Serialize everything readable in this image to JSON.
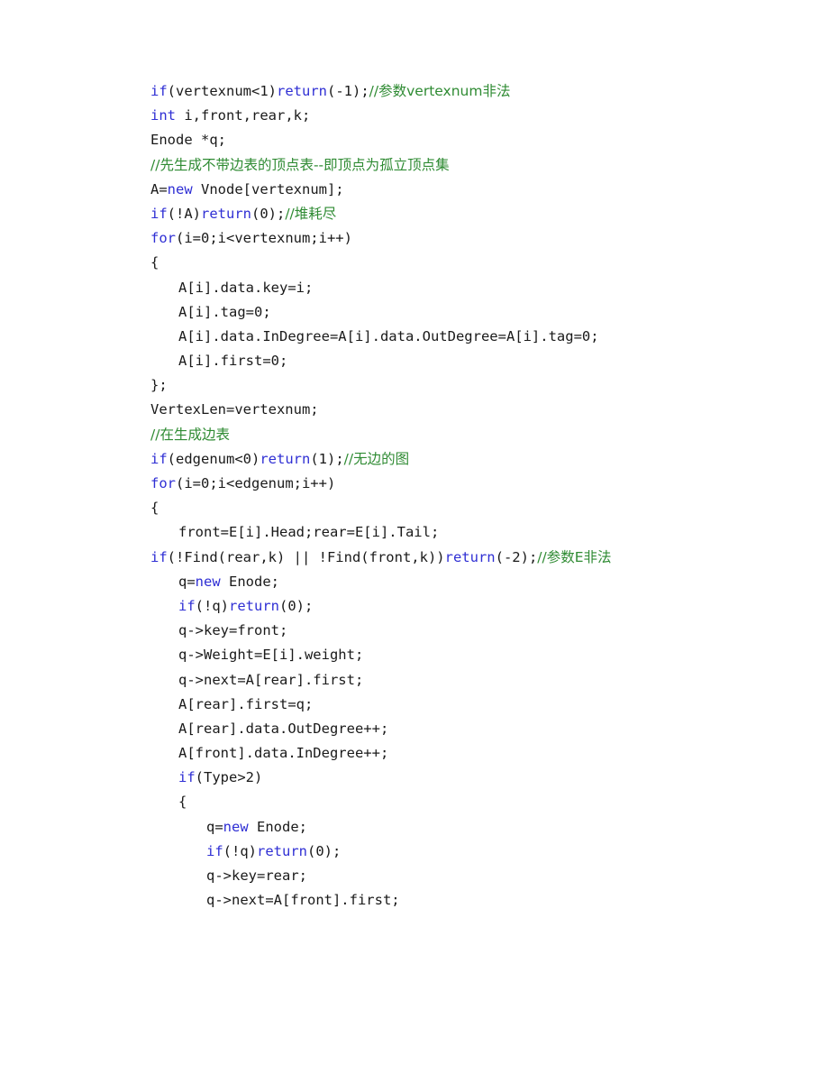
{
  "document": {
    "type": "code-listing",
    "language": "C++",
    "colors": {
      "keyword": "#2f2fd4",
      "comment": "#2f8b33",
      "text": "#1a1a1a",
      "background": "#ffffff"
    }
  },
  "code": {
    "lines": [
      {
        "indent": 0,
        "tokens": [
          {
            "t": "kw",
            "s": "if"
          },
          {
            "t": "txt",
            "s": "(vertexnum<1)"
          },
          {
            "t": "kw",
            "s": "return"
          },
          {
            "t": "txt",
            "s": "(-1);"
          },
          {
            "t": "cmt",
            "s": "//参数vertexnum非法"
          }
        ]
      },
      {
        "indent": 0,
        "tokens": [
          {
            "t": "kw",
            "s": "int"
          },
          {
            "t": "txt",
            "s": " i,front,rear,k;"
          }
        ]
      },
      {
        "indent": 0,
        "tokens": [
          {
            "t": "txt",
            "s": "Enode *q;"
          }
        ]
      },
      {
        "indent": 0,
        "tokens": [
          {
            "t": "cmt",
            "s": "//先生成不带边表的顶点表--即顶点为孤立顶点集"
          }
        ]
      },
      {
        "indent": 0,
        "tokens": [
          {
            "t": "txt",
            "s": "A="
          },
          {
            "t": "kw",
            "s": "new"
          },
          {
            "t": "txt",
            "s": " Vnode[vertexnum];"
          }
        ]
      },
      {
        "indent": 0,
        "tokens": [
          {
            "t": "kw",
            "s": "if"
          },
          {
            "t": "txt",
            "s": "(!A)"
          },
          {
            "t": "kw",
            "s": "return"
          },
          {
            "t": "txt",
            "s": "(0);"
          },
          {
            "t": "cmt",
            "s": "//堆耗尽"
          }
        ]
      },
      {
        "indent": 0,
        "tokens": [
          {
            "t": "kw",
            "s": "for"
          },
          {
            "t": "txt",
            "s": "(i=0;i<vertexnum;i++)"
          }
        ]
      },
      {
        "indent": 0,
        "tokens": [
          {
            "t": "txt",
            "s": "{"
          }
        ]
      },
      {
        "indent": 1,
        "tokens": [
          {
            "t": "txt",
            "s": "A[i].data.key=i;"
          }
        ]
      },
      {
        "indent": 1,
        "tokens": [
          {
            "t": "txt",
            "s": "A[i].tag=0;"
          }
        ]
      },
      {
        "indent": 1,
        "tokens": [
          {
            "t": "txt",
            "s": "A[i].data.InDegree=A[i].data.OutDegree=A[i].tag=0;"
          }
        ]
      },
      {
        "indent": 1,
        "tokens": [
          {
            "t": "txt",
            "s": "A[i].first=0;"
          }
        ]
      },
      {
        "indent": 0,
        "tokens": [
          {
            "t": "txt",
            "s": "};"
          }
        ]
      },
      {
        "indent": 0,
        "tokens": [
          {
            "t": "txt",
            "s": "VertexLen=vertexnum;"
          }
        ]
      },
      {
        "indent": 0,
        "tokens": [
          {
            "t": "cmt",
            "s": "//在生成边表"
          }
        ]
      },
      {
        "indent": 0,
        "tokens": [
          {
            "t": "kw",
            "s": "if"
          },
          {
            "t": "txt",
            "s": "(edgenum<0)"
          },
          {
            "t": "kw",
            "s": "return"
          },
          {
            "t": "txt",
            "s": "(1);"
          },
          {
            "t": "cmt",
            "s": "//无边的图"
          }
        ]
      },
      {
        "indent": 0,
        "tokens": [
          {
            "t": "kw",
            "s": "for"
          },
          {
            "t": "txt",
            "s": "(i=0;i<edgenum;i++)"
          }
        ]
      },
      {
        "indent": 0,
        "tokens": [
          {
            "t": "txt",
            "s": "{"
          }
        ]
      },
      {
        "indent": 1,
        "tokens": [
          {
            "t": "txt",
            "s": "front=E[i].Head;rear=E[i].Tail;"
          }
        ]
      },
      {
        "indent": 1,
        "wrap": true,
        "tokens": [
          {
            "t": "kw",
            "s": "if"
          },
          {
            "t": "txt",
            "s": "(!Find(rear,k) || !Find(front,k))"
          },
          {
            "t": "kw",
            "s": "return"
          },
          {
            "t": "txt",
            "s": "(-2);"
          },
          {
            "t": "cmt",
            "s": "//参数E非法"
          }
        ]
      },
      {
        "indent": 1,
        "tokens": [
          {
            "t": "txt",
            "s": "q="
          },
          {
            "t": "kw",
            "s": "new"
          },
          {
            "t": "txt",
            "s": " Enode;"
          }
        ]
      },
      {
        "indent": 1,
        "tokens": [
          {
            "t": "kw",
            "s": "if"
          },
          {
            "t": "txt",
            "s": "(!q)"
          },
          {
            "t": "kw",
            "s": "return"
          },
          {
            "t": "txt",
            "s": "(0);"
          }
        ]
      },
      {
        "indent": 1,
        "tokens": [
          {
            "t": "txt",
            "s": "q->key=front;"
          }
        ]
      },
      {
        "indent": 1,
        "tokens": [
          {
            "t": "txt",
            "s": "q->Weight=E[i].weight;"
          }
        ]
      },
      {
        "indent": 1,
        "tokens": [
          {
            "t": "txt",
            "s": "q->next=A[rear].first;"
          }
        ]
      },
      {
        "indent": 1,
        "tokens": [
          {
            "t": "txt",
            "s": "A[rear].first=q;"
          }
        ]
      },
      {
        "indent": 1,
        "tokens": [
          {
            "t": "txt",
            "s": "A[rear].data.OutDegree++;"
          }
        ]
      },
      {
        "indent": 1,
        "tokens": [
          {
            "t": "txt",
            "s": "A[front].data.InDegree++;"
          }
        ]
      },
      {
        "indent": 1,
        "tokens": [
          {
            "t": "kw",
            "s": "if"
          },
          {
            "t": "txt",
            "s": "(Type>2)"
          }
        ]
      },
      {
        "indent": 1,
        "tokens": [
          {
            "t": "txt",
            "s": "{"
          }
        ]
      },
      {
        "indent": 2,
        "tokens": [
          {
            "t": "txt",
            "s": "q="
          },
          {
            "t": "kw",
            "s": "new"
          },
          {
            "t": "txt",
            "s": " Enode;"
          }
        ]
      },
      {
        "indent": 2,
        "tokens": [
          {
            "t": "kw",
            "s": "if"
          },
          {
            "t": "txt",
            "s": "(!q)"
          },
          {
            "t": "kw",
            "s": "return"
          },
          {
            "t": "txt",
            "s": "(0);"
          }
        ]
      },
      {
        "indent": 2,
        "tokens": [
          {
            "t": "txt",
            "s": "q->key=rear;"
          }
        ]
      },
      {
        "indent": 2,
        "tokens": [
          {
            "t": "txt",
            "s": "q->next=A[front].first;"
          }
        ]
      }
    ]
  }
}
